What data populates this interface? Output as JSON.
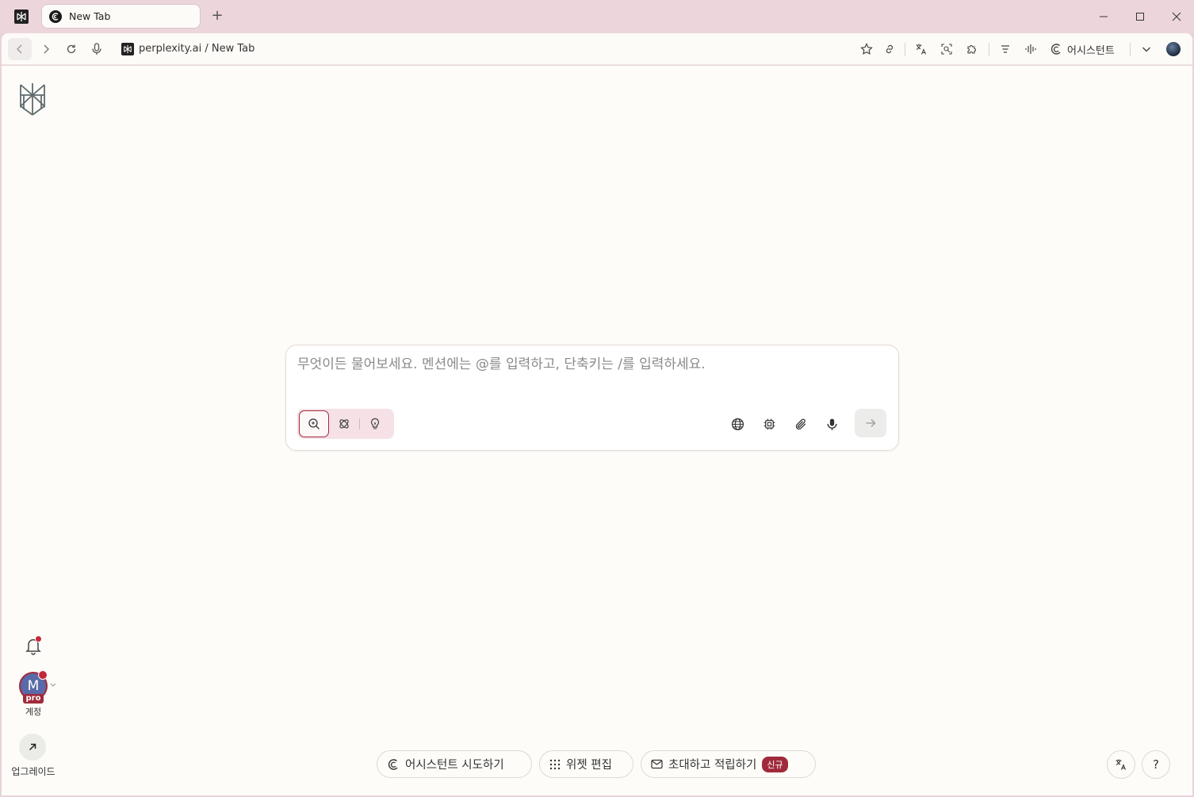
{
  "window": {
    "tab_title": "New Tab",
    "new_tab_symbol": "+"
  },
  "toolbar": {
    "url_domain": "perplexity.ai",
    "url_separator": " / ",
    "url_page": "New Tab",
    "assistant_label": "어시스턴트"
  },
  "search": {
    "placeholder": "무엇이든 물어보세요. 멘션에는 @를 입력하고, 단축키는 /를 입력하세요."
  },
  "sidebar": {
    "account_initial": "M",
    "pro_badge": "pro",
    "account_label": "계정",
    "upgrade_label": "업그레이드"
  },
  "bottom": {
    "try_assistant": "어시스턴트 시도하기",
    "edit_widgets": "위젯 편집",
    "invite_earn": "초대하고 적립하기",
    "new_badge": "신규",
    "help_symbol": "?"
  },
  "colors": {
    "accent": "#a02a3c",
    "titlebar": "#ecd6dc",
    "page_bg": "#fdfcf8"
  }
}
